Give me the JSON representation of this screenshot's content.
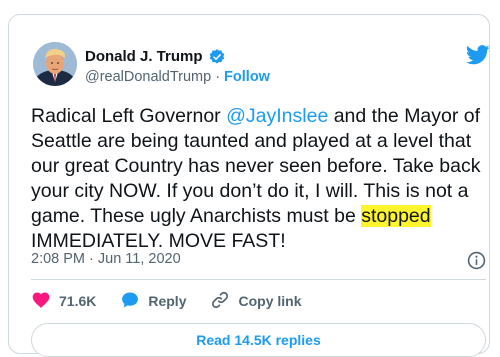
{
  "author": {
    "name": "Donald J. Trump",
    "handle": "@realDonaldTrump",
    "separator": "·",
    "follow_label": "Follow"
  },
  "tweet": {
    "line1_pre": "Radical Left Governor ",
    "mention": "@JayInslee",
    "line1_post": " and the Mayor of Seattle are being taunted and played at a level that our great Country has never seen before. Take back your city NOW. If you don’t do it, I will. This is not a game. These ugly Anarchists must be ",
    "highlighted_word": "stopped",
    "line_end": "\nIMMEDIATELY. MOVE FAST!"
  },
  "timestamp": "2:08 PM · Jun 11, 2020",
  "actions": {
    "like_count": "71.6K",
    "reply_label": "Reply",
    "copy_link_label": "Copy link"
  },
  "read_replies_label": "Read 14.5K replies",
  "colors": {
    "accent": "#1d9bf0",
    "like": "#f91880",
    "highlight": "#fff52e",
    "secondary_text": "#536471",
    "border": "#cfd9de"
  },
  "icons": {
    "avatar": "profile-photo",
    "verified": "verified-badge-icon",
    "logo": "twitter-bird-icon",
    "info": "info-icon",
    "like": "heart-icon",
    "reply": "speech-bubble-icon",
    "copy_link": "link-icon"
  }
}
